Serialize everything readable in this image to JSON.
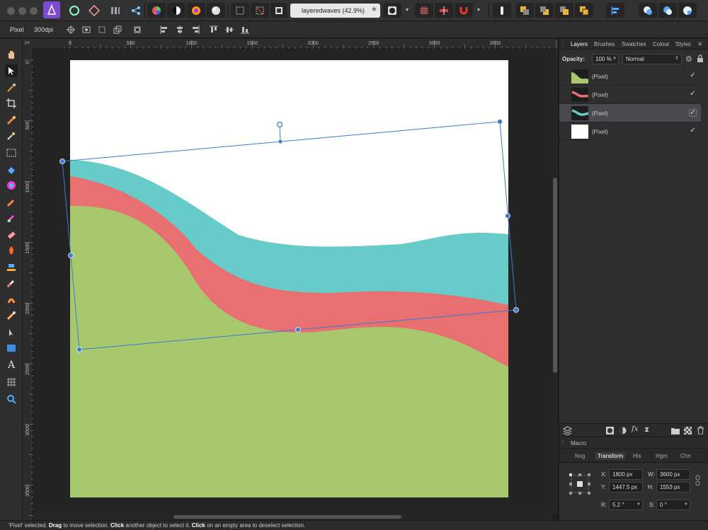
{
  "document": {
    "title": "layeredwaves (42.9%)"
  },
  "context_bar": {
    "label": "Pixel",
    "dpi": "300dpi"
  },
  "ruler": {
    "unit": "px",
    "top_labels": [
      "0",
      "500",
      "1000",
      "1500",
      "2000",
      "2500",
      "3000",
      "3500"
    ],
    "left_labels": [
      "0",
      "500",
      "1000",
      "1500",
      "2000",
      "2500",
      "3000",
      "3500"
    ]
  },
  "panel": {
    "tabs": [
      "Layers",
      "Brushes",
      "Swatches",
      "Colour",
      "Styles"
    ],
    "opacity_label": "Opacity:",
    "opacity_value": "100 %",
    "blend_mode": "Normal",
    "layers": [
      {
        "name": "(Pixel)",
        "thumb": "green-wave",
        "selected": false
      },
      {
        "name": "(Pixel)",
        "thumb": "red-wave",
        "selected": false
      },
      {
        "name": "(Pixel)",
        "thumb": "teal-wave",
        "selected": true
      },
      {
        "name": "(Pixel)",
        "thumb": "white",
        "selected": false
      }
    ],
    "macro_label": "Macro",
    "transform_tabs": [
      "Nvg",
      "Transform",
      "His",
      "Hgm",
      "Chn"
    ],
    "transform": {
      "x_label": "X:",
      "x": "1800 px",
      "y_label": "Y:",
      "y": "1447.5 px",
      "w_label": "W:",
      "w": "3600 px",
      "h_label": "H:",
      "h": "1553 px",
      "r_label": "R:",
      "r": "5.2 °",
      "s_label": "S:",
      "s": "0 °"
    }
  },
  "status": {
    "p1": "'Pixel' selected. ",
    "b1": "Drag",
    "p2": " to move selection. ",
    "b2": "Click",
    "p3": " another object to select it. ",
    "b3": "Click",
    "p4": " on an empty area to deselect selection."
  },
  "colors": {
    "green": "#a8c86e",
    "red": "#e87070",
    "teal": "#66cbc9",
    "selection": "#3a7bd5"
  }
}
